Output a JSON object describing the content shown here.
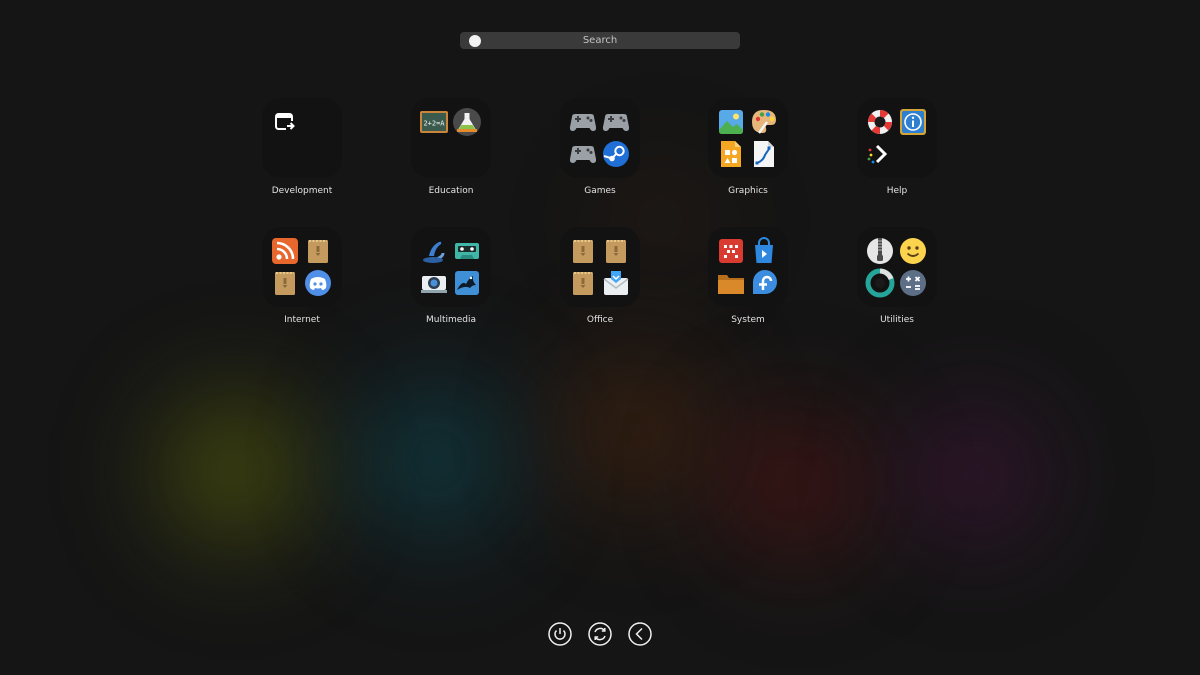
{
  "search": {
    "placeholder": "Search"
  },
  "folders": [
    {
      "label": "Development",
      "icons": [
        "window-share-icon"
      ]
    },
    {
      "label": "Education",
      "icons": [
        "chalkboard-math-icon",
        "chemistry-flask-icon"
      ]
    },
    {
      "label": "Games",
      "icons": [
        "gamepad-icon",
        "gamepad-icon",
        "gamepad-icon",
        "steam-icon"
      ]
    },
    {
      "label": "Graphics",
      "icons": [
        "image-viewer-icon",
        "paint-palette-icon",
        "shapes-document-icon",
        "vector-drawing-icon"
      ]
    },
    {
      "label": "Help",
      "icons": [
        "lifebuoy-icon",
        "info-icon",
        "terminal-prompt-icon"
      ]
    },
    {
      "label": "Internet",
      "icons": [
        "rss-feed-icon",
        "package-icon",
        "package-icon",
        "discord-icon"
      ]
    },
    {
      "label": "Multimedia",
      "icons": [
        "music-note-icon",
        "cassette-icon",
        "webcam-icon",
        "video-editor-icon"
      ]
    },
    {
      "label": "Office",
      "icons": [
        "package-icon",
        "package-icon",
        "package-icon",
        "mail-icon"
      ]
    },
    {
      "label": "System",
      "icons": [
        "monitor-icon",
        "software-store-icon",
        "folder-icon",
        "fedora-icon"
      ]
    },
    {
      "label": "Utilities",
      "icons": [
        "archive-zipper-icon",
        "emoji-icon",
        "disk-usage-icon",
        "calculator-icon"
      ]
    }
  ],
  "bottom_bar": {
    "icons": [
      "power-icon",
      "restart-icon",
      "logout-icon"
    ]
  }
}
